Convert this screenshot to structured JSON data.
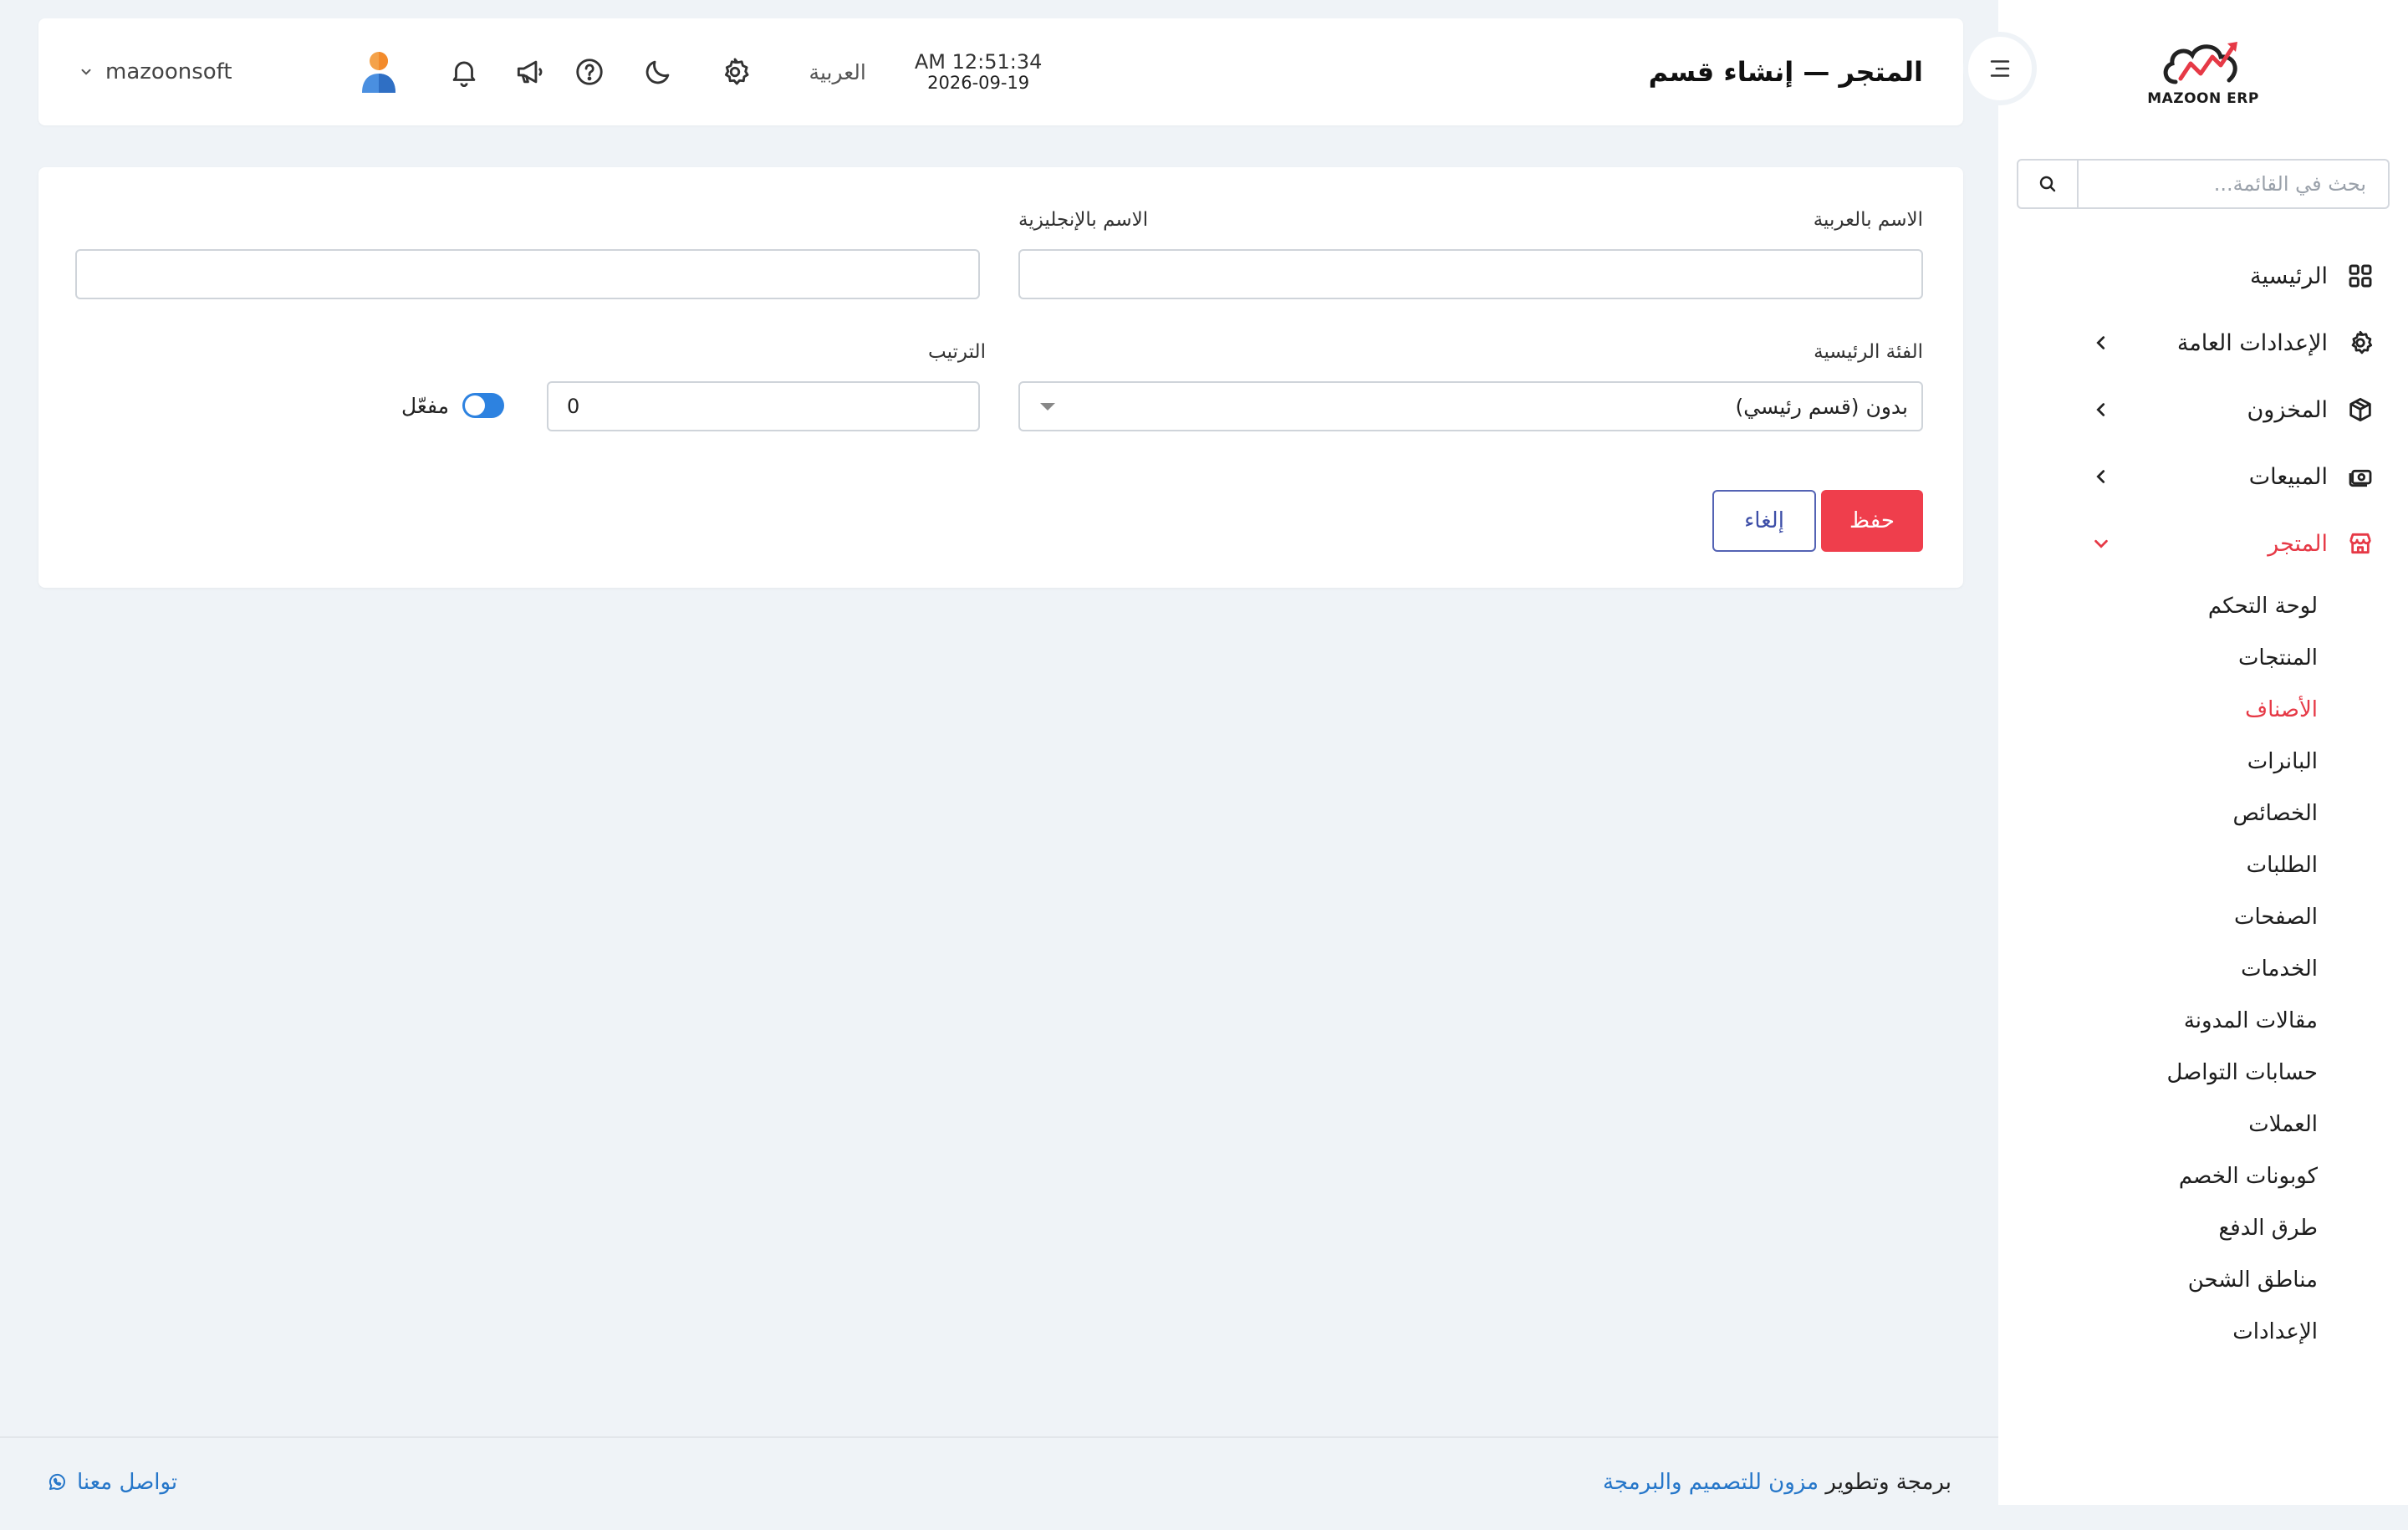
{
  "brand": {
    "logo_text": "MAZOON ERP",
    "accent": "#e63946"
  },
  "sidebar": {
    "search_placeholder": "بحث في القائمة...",
    "items": [
      {
        "label": "الرئيسية",
        "icon": "grid-icon",
        "expandable": false
      },
      {
        "label": "الإعدادات العامة",
        "icon": "gear-icon",
        "expandable": true
      },
      {
        "label": "المخزون",
        "icon": "box-icon",
        "expandable": true
      },
      {
        "label": "المبيعات",
        "icon": "cash-icon",
        "expandable": true
      },
      {
        "label": "المتجر",
        "icon": "store-icon",
        "expandable": true,
        "expanded": true
      }
    ],
    "store_sub": [
      "لوحة التحكم",
      "المنتجات",
      "الأصناف",
      "البانرات",
      "الخصائص",
      "الطلبات",
      "الصفحات",
      "الخدمات",
      "مقالات المدونة",
      "حسابات التواصل",
      "العملات",
      "كوبونات الخصم",
      "طرق الدفع",
      "مناطق الشحن",
      "الإعدادات"
    ],
    "store_sub_active": "الأصناف"
  },
  "header": {
    "title": "المتجر — إنشاء قسم",
    "time": "AM 12:51:34",
    "date": "2026-09-19",
    "language": "العربية",
    "username": "mazoonsoft"
  },
  "form": {
    "name_ar_label": "الاسم بالعربية",
    "name_ar_value": "",
    "name_en_label": "الاسم بالإنجليزية",
    "name_en_value": "",
    "parent_label": "الفئة الرئيسية",
    "parent_value": "بدون (قسم رئيسي)",
    "order_label": "الترتيب",
    "order_value": "0",
    "active_label": "مفعّل",
    "active": true,
    "save_label": "حفظ",
    "cancel_label": "إلغاء"
  },
  "footer": {
    "credit_prefix": "برمجة وتطوير",
    "credit_link": "مزون للتصميم والبرمجة",
    "contact_label": "تواصل معنا"
  }
}
